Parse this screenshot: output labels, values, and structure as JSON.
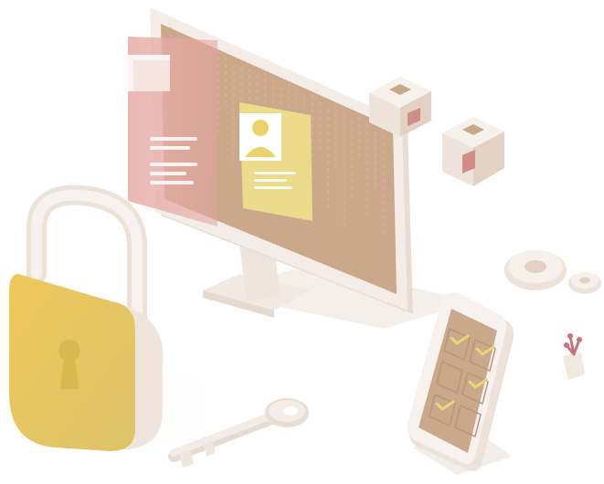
{
  "illustration": {
    "theme": "data-security",
    "objects": [
      "monitor-icon",
      "profile-card-icon",
      "padlock-icon",
      "key-icon",
      "smartphone-icon",
      "checklist-icon",
      "gear-icon",
      "cube-icon",
      "plant-icon"
    ]
  },
  "colors": {
    "background": "#ffffff",
    "screen": "#c9a98a",
    "screen_dark": "#b8967a",
    "bezel": "#f3ece6",
    "bezel_shadow": "#e4d6ca",
    "accent_pink": "#e3a4a0",
    "accent_pink_dark": "#d08c88",
    "accent_yellow": "#e9d36a",
    "accent_yellow_dark": "#d9b851",
    "card_yellow": "#efe08a",
    "check_yellow": "#e7d77a",
    "plant": "#c9727a"
  },
  "checklist": {
    "checked": [
      true,
      true,
      false,
      true,
      true,
      false
    ]
  }
}
